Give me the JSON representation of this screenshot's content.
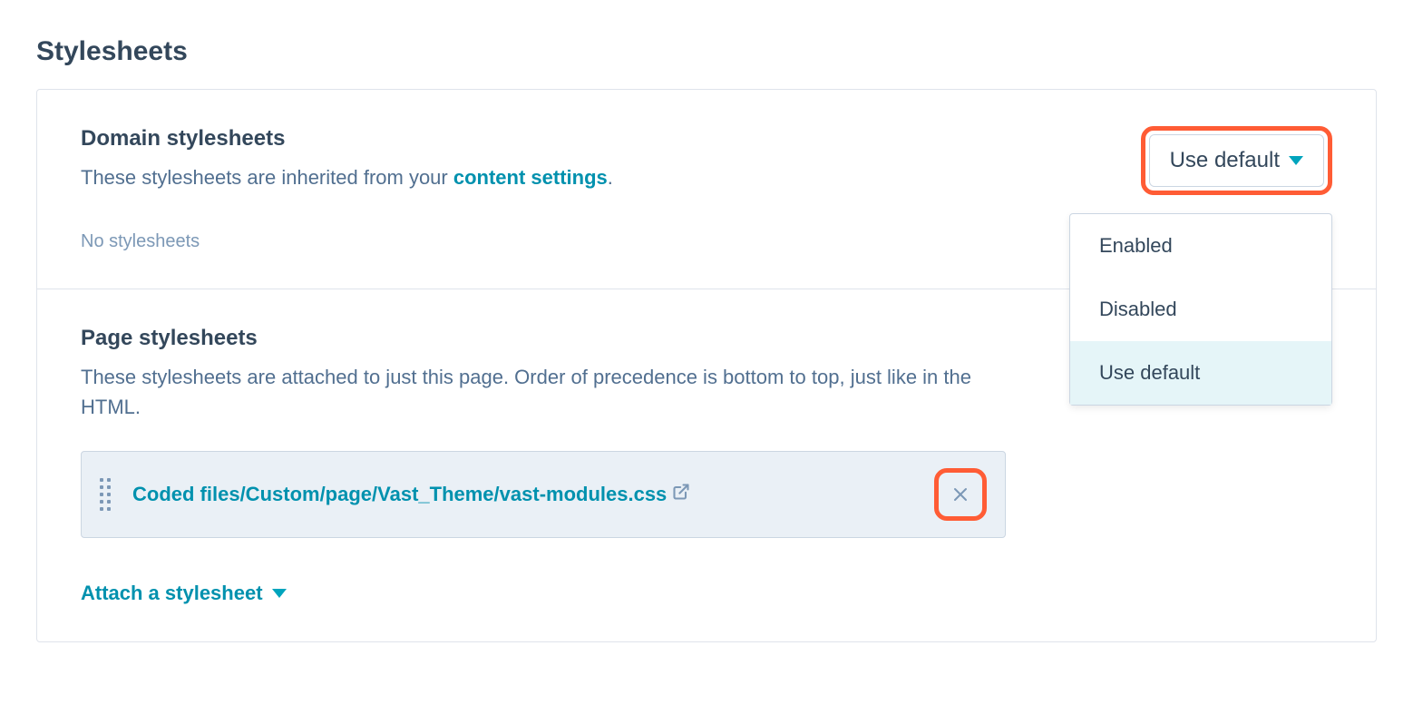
{
  "page_title": "Stylesheets",
  "domain_section": {
    "title": "Domain stylesheets",
    "desc_before": "These stylesheets are inherited from your ",
    "desc_link": "content settings",
    "desc_after": ".",
    "empty_text": "No stylesheets",
    "dropdown": {
      "selected": "Use default",
      "options": [
        "Enabled",
        "Disabled",
        "Use default"
      ]
    }
  },
  "page_section": {
    "title": "Page stylesheets",
    "desc": "These stylesheets are attached to just this page. Order of precedence is bottom to top, just like in the HTML.",
    "stylesheet_path": "Coded files/Custom/page/Vast_Theme/vast-modules.css",
    "attach_label": "Attach a stylesheet"
  }
}
